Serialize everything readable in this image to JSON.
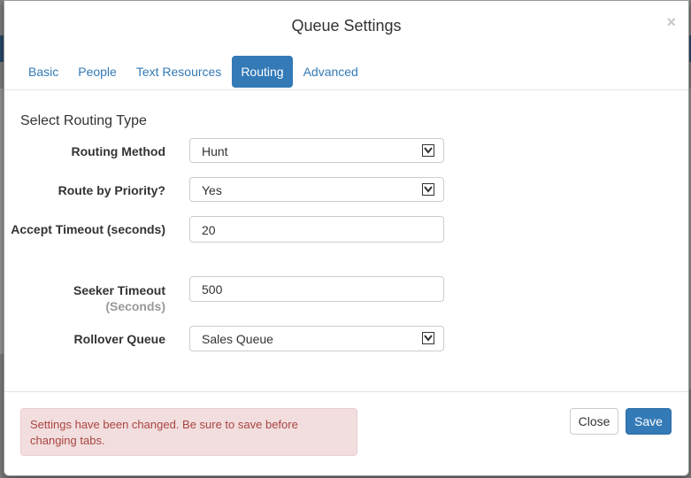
{
  "dialog": {
    "title": "Queue Settings",
    "close_glyph": "×"
  },
  "tabs": [
    {
      "label": "Basic",
      "active": false
    },
    {
      "label": "People",
      "active": false
    },
    {
      "label": "Text Resources",
      "active": false
    },
    {
      "label": "Routing",
      "active": true
    },
    {
      "label": "Advanced",
      "active": false
    }
  ],
  "section": {
    "title": "Select Routing Type"
  },
  "fields": {
    "routing_method": {
      "label": "Routing Method",
      "value": "Hunt",
      "type": "select"
    },
    "route_by_priority": {
      "label": "Route by Priority?",
      "value": "Yes",
      "type": "select"
    },
    "accept_timeout": {
      "label": "Accept Timeout (seconds)",
      "value": "20",
      "type": "input"
    },
    "seeker_timeout": {
      "label": "Seeker Timeout",
      "sublabel": "(Seconds)",
      "value": "500",
      "type": "input"
    },
    "rollover_queue": {
      "label": "Rollover Queue",
      "value": "Sales Queue",
      "type": "select"
    }
  },
  "alert": {
    "text": "Settings have been changed. Be sure to save before changing tabs."
  },
  "buttons": {
    "close": "Close",
    "save": "Save"
  },
  "colors": {
    "primary": "#337ab7",
    "alert_bg": "#f2dede",
    "alert_text": "#a94442"
  }
}
